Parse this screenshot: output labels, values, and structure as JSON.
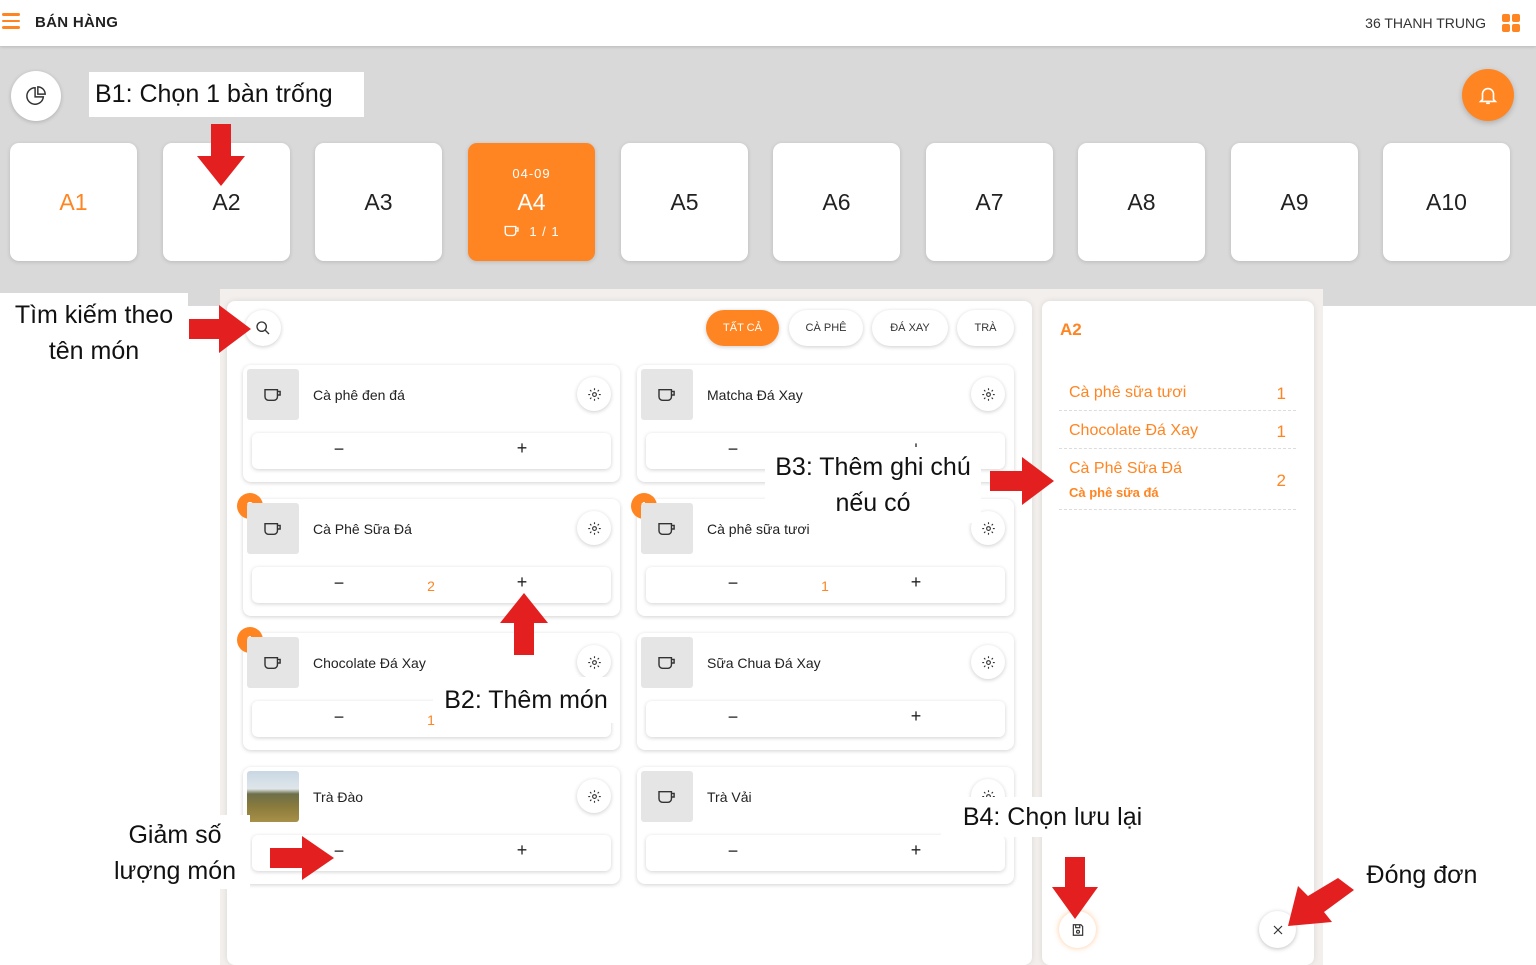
{
  "topbar": {
    "title": "BÁN HÀNG",
    "user": "36 THANH TRUNG"
  },
  "tables": [
    {
      "name": "A1",
      "state": "selected-empty"
    },
    {
      "name": "A2",
      "state": "empty"
    },
    {
      "name": "A3",
      "state": "empty"
    },
    {
      "name": "A4",
      "state": "busy",
      "time": "04-09",
      "count": "1 / 1"
    },
    {
      "name": "A5",
      "state": "empty"
    },
    {
      "name": "A6",
      "state": "empty"
    },
    {
      "name": "A7",
      "state": "empty"
    },
    {
      "name": "A8",
      "state": "empty"
    },
    {
      "name": "A9",
      "state": "empty"
    },
    {
      "name": "A10",
      "state": "empty"
    }
  ],
  "categories": [
    "TẤT CẢ",
    "CÀ PHÊ",
    "ĐÁ XAY",
    "TRÀ"
  ],
  "items": [
    {
      "name": "Cà phê đen đá",
      "qty": "",
      "badge": ""
    },
    {
      "name": "Matcha Đá Xay",
      "qty": "",
      "badge": ""
    },
    {
      "name": "Cà Phê Sữa Đá",
      "qty": "2",
      "badge": "2"
    },
    {
      "name": "Cà phê sữa tươi",
      "qty": "1",
      "badge": "1"
    },
    {
      "name": "Chocolate Đá Xay",
      "qty": "1",
      "badge": "1"
    },
    {
      "name": "Sữa Chua Đá Xay",
      "qty": "",
      "badge": ""
    },
    {
      "name": "Trà Đào",
      "qty": "",
      "badge": ""
    },
    {
      "name": "Trà Vải",
      "qty": "",
      "badge": ""
    }
  ],
  "qty_controls": {
    "minus": "−",
    "plus": "+"
  },
  "order": {
    "table": "A2",
    "lines": [
      {
        "name": "Cà phê sữa tươi",
        "qty": "1",
        "note": ""
      },
      {
        "name": "Chocolate Đá Xay",
        "qty": "1",
        "note": ""
      },
      {
        "name": "Cà Phê Sữa Đá",
        "qty": "2",
        "note": "Cà phê sữa đá"
      }
    ]
  },
  "annotations": {
    "b1": "B1: Chọn 1 bàn trống",
    "search": "Tìm kiếm theo tên món",
    "b2": "B2: Thêm món",
    "b3": "B3: Thêm ghi chú nếu có",
    "decrease": "Giảm số lượng món",
    "b4": "B4: Chọn lưu lại",
    "close": "Đóng đơn"
  },
  "colors": {
    "accent": "#ff8522",
    "arrow": "#e41f1f",
    "background": "#d9d9d9"
  },
  "icons": [
    "menu-icon",
    "grid-icon",
    "chart-icon",
    "bell-icon",
    "search-icon",
    "cup-icon",
    "gear-icon",
    "save-icon",
    "close-icon"
  ]
}
